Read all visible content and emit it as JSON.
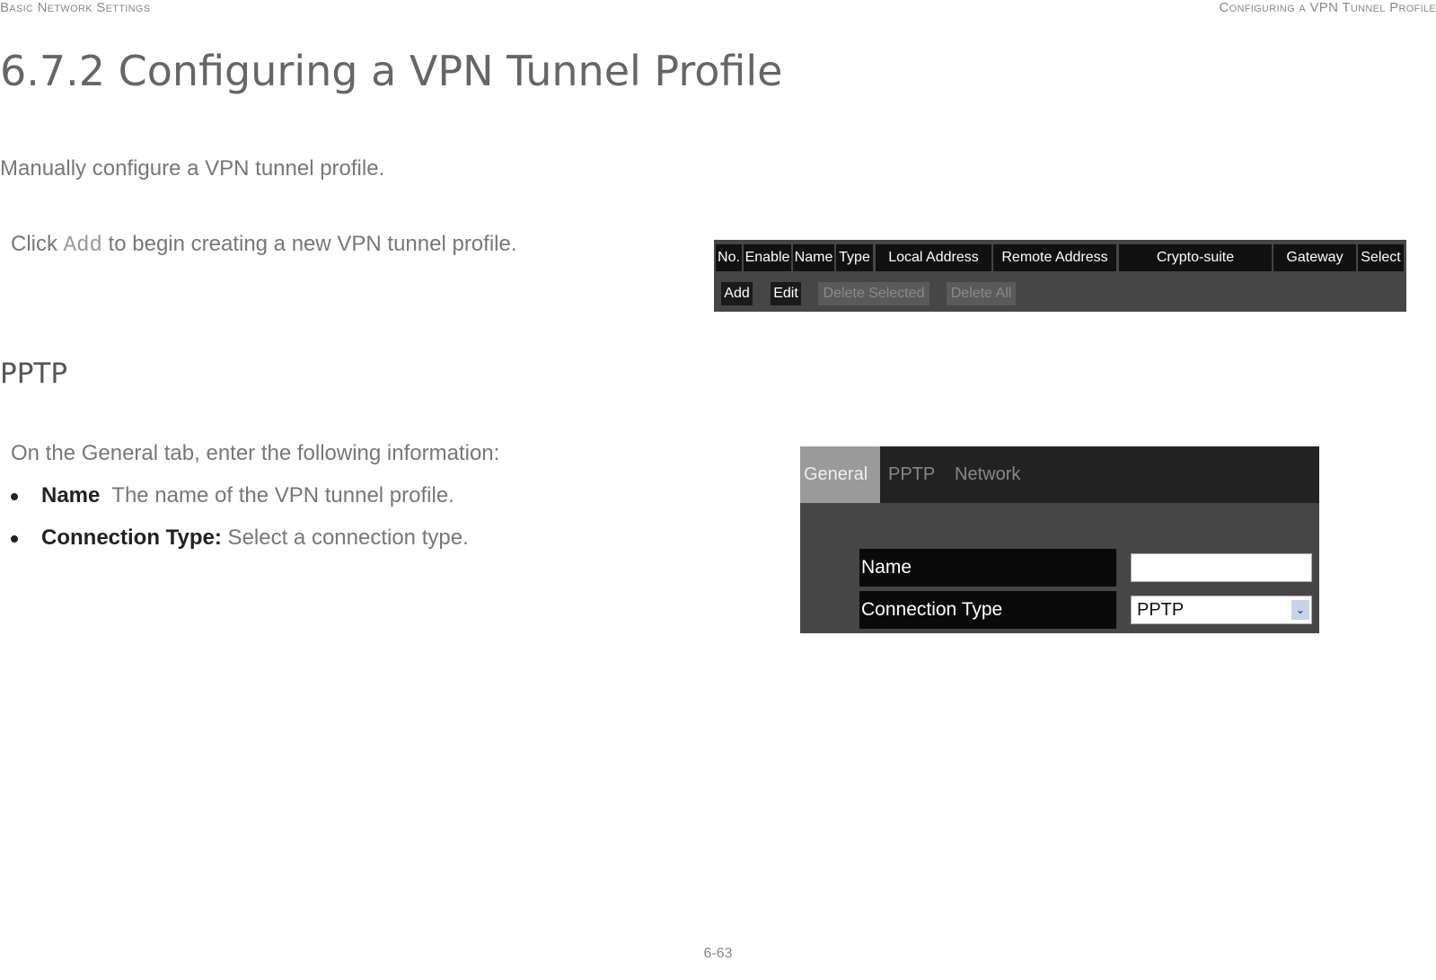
{
  "header": {
    "left": "Basic Network Settings",
    "right": "Configuring a VPN Tunnel Profile"
  },
  "title": "6.7.2 Configuring a VPN Tunnel Profile",
  "intro": "Manually configure a VPN tunnel profile.",
  "click_add": {
    "pre": "Click ",
    "code": "Add",
    "post": " to begin creating a new VPN tunnel profile."
  },
  "table_ui": {
    "columns": [
      "No.",
      "Enable",
      "Name",
      "Type",
      "Local Address",
      "Remote Address",
      "Crypto-suite",
      "Gateway",
      "Select"
    ],
    "buttons": [
      "Add",
      "Edit",
      "Delete Selected",
      "Delete All"
    ]
  },
  "section": "PPTP",
  "general_intro": "On the General tab, enter the following information:",
  "bullets": [
    {
      "term": "Name",
      "text": "  The name of the VPN tunnel profile."
    },
    {
      "term": "Connection Type:",
      "text": " Select a connection type."
    }
  ],
  "form_ui": {
    "tabs": [
      "General",
      "PPTP",
      "Network"
    ],
    "name_label": "Name",
    "name_value": "",
    "conn_label": "Connection Type",
    "conn_value": "PPTP"
  },
  "footer": "6-63"
}
